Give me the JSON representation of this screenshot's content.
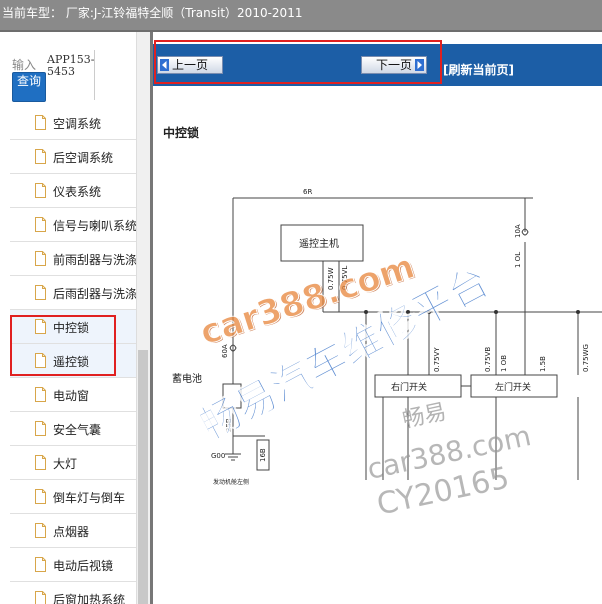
{
  "header": {
    "vehicle_text": "当前车型： 厂家:J-江铃福特全顺（Transit）2010-2011"
  },
  "search": {
    "label": "输入",
    "button_label": "查询",
    "app_code": "APP153-5453"
  },
  "menu": {
    "items": [
      {
        "label": "空调系统"
      },
      {
        "label": "后空调系统"
      },
      {
        "label": "仪表系统"
      },
      {
        "label": "信号与喇叭系统"
      },
      {
        "label": "前雨刮器与洗涤"
      },
      {
        "label": "后雨刮器与洗涤"
      },
      {
        "label": "中控锁"
      },
      {
        "label": "遥控锁"
      },
      {
        "label": "电动窗"
      },
      {
        "label": "安全气囊"
      },
      {
        "label": "大灯"
      },
      {
        "label": "倒车灯与倒车"
      },
      {
        "label": "点烟器"
      },
      {
        "label": "电动后视镜"
      },
      {
        "label": "后窗加热系统"
      }
    ]
  },
  "nav": {
    "prev_label": "上一页",
    "next_label": "下一页",
    "refresh_label": "[刷新当前页]"
  },
  "diagram": {
    "title": "中控锁",
    "labels": {
      "wire_top": "6R",
      "remote_host": "遥控主机",
      "battery": "蓄电池",
      "fuse_10a": "10A",
      "wire_1ol": "1 OL",
      "wire_075w": "0.75W",
      "wire_075vl": "0.75VL",
      "wire_60a": "60A",
      "wire_25b": "25B",
      "wire_16b": "16B",
      "ground": "G00",
      "door_switch_right": "右门开关",
      "door_switch_left": "左门开关",
      "wire_075vy": "0.75VY",
      "wire_075vb": "0.75VB",
      "wire_1ob": "1 OB",
      "wire_15b": "1.5B",
      "wire_075wg": "0.75WG",
      "engine_note": "发动机舱左侧"
    }
  },
  "watermarks": {
    "car388_a": "car388.com",
    "site_cn": "畅易汽车维修平台",
    "changyi": "畅易",
    "car388_b": "car388.com",
    "cy": "CY20165"
  },
  "colors": {
    "nav_bg": "#1c5ea6",
    "button_blue": "#1f6fc2",
    "highlight": "#e02020",
    "topbar": "#8a8a8a"
  }
}
